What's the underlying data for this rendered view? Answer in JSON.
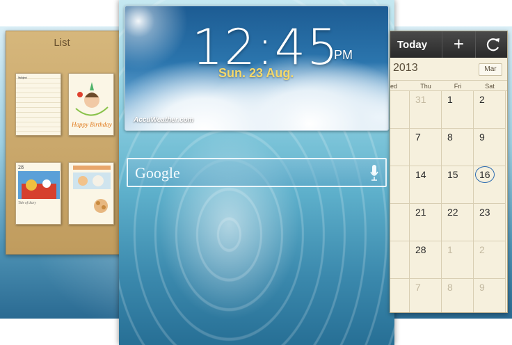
{
  "memo": {
    "title": "List",
    "card1_heading": "Subject",
    "card2_text": "Happy Birthday",
    "card3_date": "28",
    "card3_caption": "Title of diary"
  },
  "clock": {
    "time": "12:45",
    "ampm": "PM",
    "date": "Sun. 23 Aug.",
    "provider": "AccuWeather.com"
  },
  "search": {
    "label": "Google"
  },
  "calendar": {
    "today_label": "Today",
    "add_label": "+",
    "year_text": "2013",
    "month_button": "Mar",
    "weekdays": [
      "ed",
      "Thu",
      "Fri",
      "Sat"
    ],
    "weeks": [
      [
        "",
        "31",
        "1",
        "2"
      ],
      [
        "",
        "7",
        "8",
        "9"
      ],
      [
        "",
        "14",
        "15",
        "16"
      ],
      [
        "",
        "21",
        "22",
        "23"
      ],
      [
        "",
        "28",
        "1",
        "2"
      ],
      [
        "",
        "7",
        "8",
        "9"
      ]
    ],
    "today": "16"
  },
  "colors": {
    "date_accent": "#f4d86a",
    "calendar_toolbar": "#2a2a2a",
    "today_circle": "#2a6ab0"
  }
}
